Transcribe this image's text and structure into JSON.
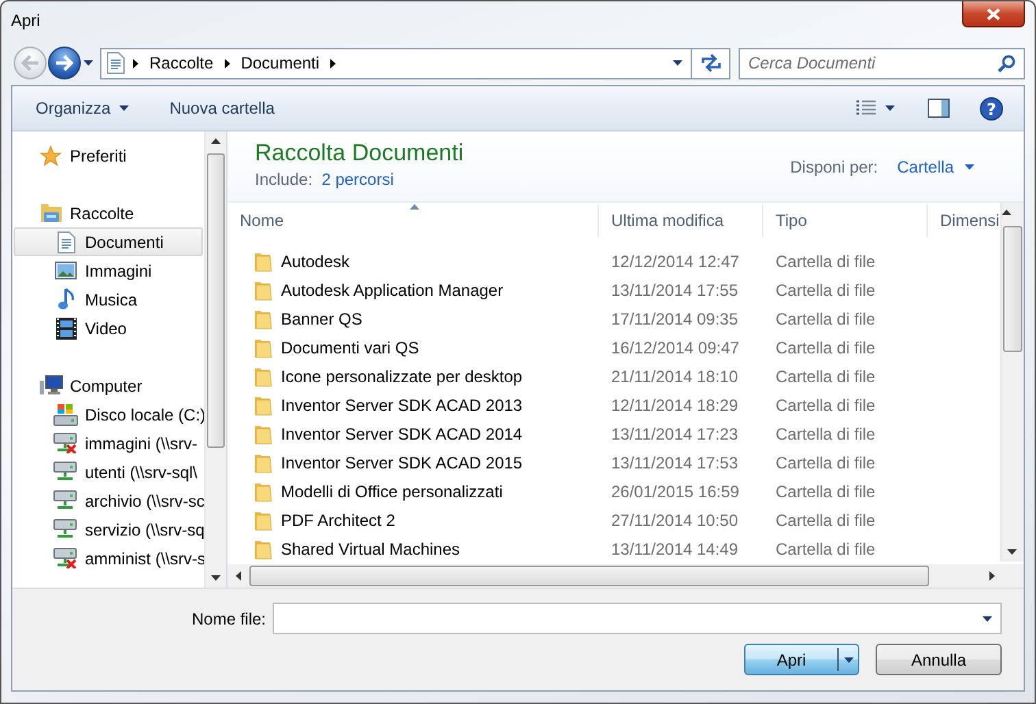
{
  "window": {
    "title": "Apri"
  },
  "navigation": {
    "back_enabled": false,
    "forward_enabled": true,
    "breadcrumbs": [
      "Raccolte",
      "Documenti"
    ],
    "search": {
      "placeholder": "Cerca Documenti"
    }
  },
  "toolbar": {
    "buttons": [
      {
        "label": "Organizza",
        "kind": "menu"
      },
      {
        "label": "Nuova cartella",
        "kind": "plain"
      }
    ],
    "help_symbol": "?"
  },
  "sidebar": {
    "groups": [
      {
        "label": "Preferiti",
        "kind": "favorites",
        "selected": false
      },
      {
        "label": "Raccolte",
        "kind": "libraries",
        "selected": false,
        "children": [
          {
            "label": "Documenti",
            "kind": "documents",
            "selected": true
          },
          {
            "label": "Immagini",
            "kind": "pictures",
            "selected": false
          },
          {
            "label": "Musica",
            "kind": "music",
            "selected": false
          },
          {
            "label": "Video",
            "kind": "video",
            "selected": false
          }
        ]
      },
      {
        "label": "Computer",
        "kind": "computer",
        "selected": false,
        "children": [
          {
            "label": "Disco locale (C:)",
            "kind": "drive",
            "selected": false
          },
          {
            "label": "immagini (\\\\srv-",
            "kind": "network",
            "connected": false,
            "selected": false
          },
          {
            "label": "utenti (\\\\srv-sql\\",
            "kind": "network",
            "connected": true,
            "selected": false
          },
          {
            "label": "archivio (\\\\srv-sc",
            "kind": "network",
            "connected": true,
            "selected": false
          },
          {
            "label": "servizio (\\\\srv-sq",
            "kind": "network",
            "connected": true,
            "selected": false
          },
          {
            "label": "amminist (\\\\srv-s",
            "kind": "network",
            "connected": false,
            "selected": false
          }
        ]
      }
    ]
  },
  "library": {
    "title": "Raccolta Documenti",
    "include_label": "Include:",
    "include_link": "2 percorsi",
    "arrange_label": "Disponi per:",
    "arrange_value": "Cartella"
  },
  "table": {
    "columns": [
      {
        "label": "Nome",
        "sorted": true
      },
      {
        "label": "Ultima modifica",
        "sorted": false
      },
      {
        "label": "Tipo",
        "sorted": false
      },
      {
        "label": "Dimensi",
        "sorted": false
      }
    ],
    "rows": [
      {
        "name": "Autodesk",
        "modified": "12/12/2014 12:47",
        "type": "Cartella di file"
      },
      {
        "name": "Autodesk Application Manager",
        "modified": "13/11/2014 17:55",
        "type": "Cartella di file"
      },
      {
        "name": "Banner QS",
        "modified": "17/11/2014 09:35",
        "type": "Cartella di file"
      },
      {
        "name": "Documenti vari QS",
        "modified": "16/12/2014 09:47",
        "type": "Cartella di file"
      },
      {
        "name": "Icone personalizzate per desktop",
        "modified": "21/11/2014 18:10",
        "type": "Cartella di file"
      },
      {
        "name": "Inventor Server SDK ACAD 2013",
        "modified": "12/11/2014 18:29",
        "type": "Cartella di file"
      },
      {
        "name": "Inventor Server SDK ACAD 2014",
        "modified": "13/11/2014 17:23",
        "type": "Cartella di file"
      },
      {
        "name": "Inventor Server SDK ACAD 2015",
        "modified": "13/11/2014 17:53",
        "type": "Cartella di file"
      },
      {
        "name": "Modelli di Office personalizzati",
        "modified": "26/01/2015 16:59",
        "type": "Cartella di file"
      },
      {
        "name": "PDF Architect 2",
        "modified": "27/11/2014 10:50",
        "type": "Cartella di file"
      },
      {
        "name": "Shared Virtual Machines",
        "modified": "13/11/2014 14:49",
        "type": "Cartella di file"
      }
    ]
  },
  "footer": {
    "filename_label": "Nome file:",
    "buttons": [
      {
        "label": "Apri",
        "kind": "split",
        "default": true
      },
      {
        "label": "Annulla",
        "kind": "plain",
        "default": false
      }
    ]
  }
}
